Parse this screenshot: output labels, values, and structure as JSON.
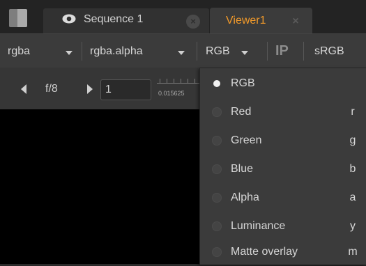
{
  "tabs": {
    "sequence": {
      "label": "Sequence 1",
      "close": "×"
    },
    "viewer": {
      "label": "Viewer1",
      "close": "×"
    }
  },
  "toolbar": {
    "channel_set": "rgba",
    "alpha_channel": "rgba.alpha",
    "display_channels": "RGB",
    "ip": "IP",
    "colorspace": "sRGB"
  },
  "controls": {
    "f_stop": "f/8",
    "frame": "1",
    "ruler_value": "0.015625"
  },
  "menu": {
    "items": [
      {
        "label": "RGB",
        "key": "",
        "selected": true
      },
      {
        "label": "Red",
        "key": "r",
        "selected": false
      },
      {
        "label": "Green",
        "key": "g",
        "selected": false
      },
      {
        "label": "Blue",
        "key": "b",
        "selected": false
      },
      {
        "label": "Alpha",
        "key": "a",
        "selected": false
      },
      {
        "label": "Luminance",
        "key": "y",
        "selected": false
      },
      {
        "label": "Matte overlay",
        "key": "m",
        "selected": false
      }
    ]
  },
  "colors": {
    "active_tab_text": "#f29a2a",
    "background": "#2a2a2a",
    "menu_background": "#3b3b3b",
    "viewer_background": "#000000"
  }
}
